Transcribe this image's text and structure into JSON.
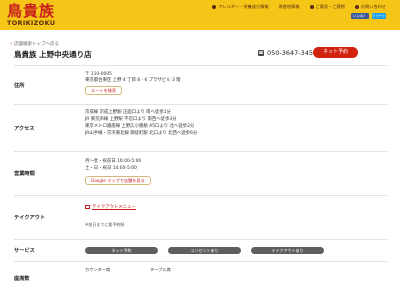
{
  "header": {
    "logo_jp": "鳥貴族",
    "logo_en": "TORIKIZOKU",
    "links": [
      "アレルギー・栄養成分情報",
      "原産地情報",
      "ご意見・ご感想",
      "お問い合わせ"
    ],
    "facebook_label": "いいね！",
    "twitter_label": "ツイート",
    "colors": {
      "bar": "#f5c518",
      "brand_red": "#c81e1e"
    }
  },
  "breadcrumb": {
    "back_label": "店舗検索トップへ戻る"
  },
  "store": {
    "name": "鳥貴族 上野中央通り店",
    "phone": "050-3647-3459",
    "reserve_label": "ネット予約"
  },
  "address": {
    "label": "住所",
    "postal": "〒 110-0005",
    "line": "東京都台東区 上野 4 丁目 8 - 6 プラザビル 3 階",
    "route_button": "ルートを検索"
  },
  "access": {
    "label": "アクセス",
    "lines": [
      "京成線 京成上野駅 正面口より 南へ徒歩1分",
      "JR 東京JR線 上野駅 不忍口より 南西へ徒歩3分",
      "東京メトロ銀座線 上野広小路駅 A5口より 北へ徒歩2分",
      "JR山手線・京浜東北線 御徒町駅 北口より 北西へ徒歩6分"
    ]
  },
  "hours": {
    "label": "営業時間",
    "lines": [
      "月～金・祝前日 16:00-5:00",
      "土・日・祝日 14:00-5:00"
    ],
    "google_button": "Google マップで店舗を見る"
  },
  "takeout": {
    "label": "テイクアウト",
    "menu_link": "テイクアウトメニュー",
    "note": "※前日までに要予約制"
  },
  "services": {
    "label": "サービス",
    "tags": [
      "ネット予約",
      "コンセントあり",
      "テイクアウトあり"
    ]
  },
  "seats": {
    "label": "座席数",
    "items": [
      "カウンター席",
      "テーブル席"
    ]
  }
}
